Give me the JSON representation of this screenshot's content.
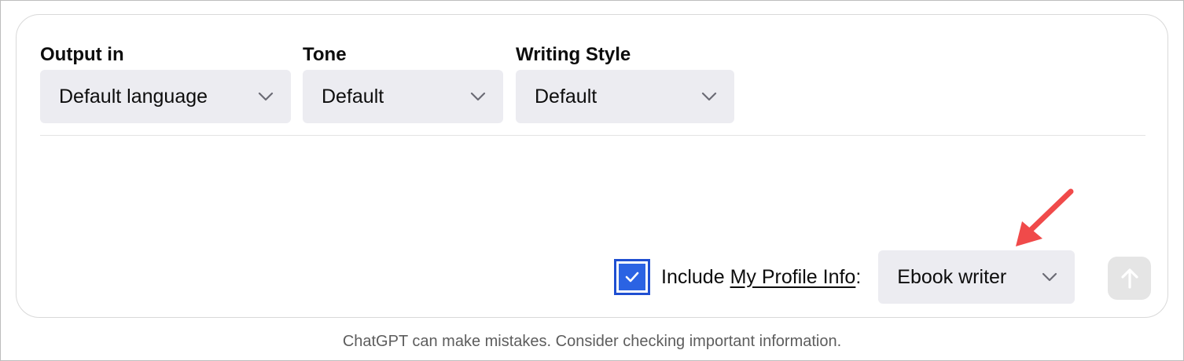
{
  "fields": [
    {
      "label": "Output in",
      "value": "Default language"
    },
    {
      "label": "Tone",
      "value": "Default"
    },
    {
      "label": "Writing Style",
      "value": "Default"
    }
  ],
  "profile": {
    "checked": true,
    "include_prefix": "Include ",
    "link_text": "My Profile Info",
    "suffix": ":",
    "selected": "Ebook writer"
  },
  "footer": {
    "disclaimer": "ChatGPT can make mistakes. Consider checking important information."
  },
  "colors": {
    "checkbox_fill": "#2b63e3",
    "annotation_arrow": "#f04a4a",
    "select_bg": "#ececf1"
  },
  "icons": {
    "dropdown": "chevron-down-icon",
    "send": "arrow-up-icon",
    "checkbox": "check-icon"
  }
}
